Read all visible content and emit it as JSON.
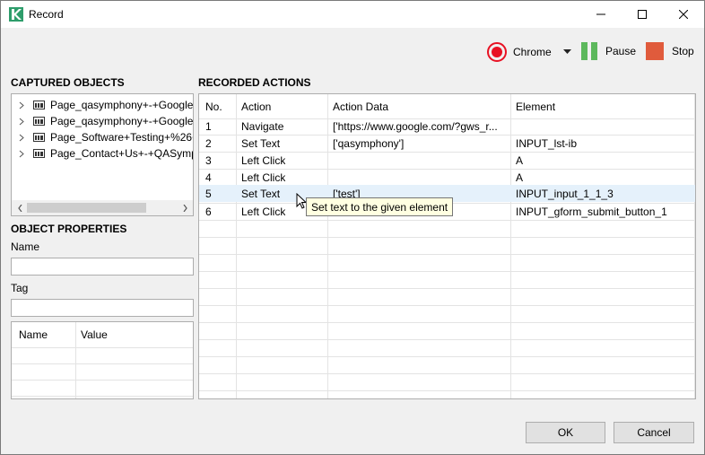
{
  "window": {
    "title": "Record"
  },
  "toolbar": {
    "browser_label": "Chrome",
    "pause_label": "Pause",
    "stop_label": "Stop"
  },
  "captured_objects": {
    "title": "CAPTURED OBJECTS",
    "items": [
      {
        "label": "Page_qasymphony+-+Google"
      },
      {
        "label": "Page_qasymphony+-+Google"
      },
      {
        "label": "Page_Software+Testing+%26+"
      },
      {
        "label": "Page_Contact+Us+-+QASymp"
      }
    ]
  },
  "object_properties": {
    "title": "OBJECT PROPERTIES",
    "name_label": "Name",
    "name_value": "",
    "tag_label": "Tag",
    "tag_value": "",
    "columns": [
      "Name",
      "Value"
    ]
  },
  "recorded_actions": {
    "title": "RECORDED ACTIONS",
    "columns": [
      "No.",
      "Action",
      "Action Data",
      "Element"
    ],
    "rows": [
      {
        "no": "1",
        "action": "Navigate",
        "data": "['https://www.google.com/?gws_r...",
        "element": ""
      },
      {
        "no": "2",
        "action": "Set Text",
        "data": "['qasymphony']",
        "element": "INPUT_lst-ib"
      },
      {
        "no": "3",
        "action": "Left Click",
        "data": "",
        "element": "A"
      },
      {
        "no": "4",
        "action": "Left Click",
        "data": "",
        "element": "A"
      },
      {
        "no": "5",
        "action": "Set Text",
        "data": "['test']",
        "element": "INPUT_input_1_1_3"
      },
      {
        "no": "6",
        "action": "Left Click",
        "data": "",
        "element": "INPUT_gform_submit_button_1"
      }
    ],
    "selected_row": 5,
    "tooltip": "Set text to the given element"
  },
  "buttons": {
    "ok": "OK",
    "cancel": "Cancel"
  },
  "colors": {
    "record": "#e81123",
    "pause": "#5cb85c",
    "stop": "#e05b3c",
    "selection": "#e5f1fb",
    "tooltip_bg": "#ffffe1"
  }
}
